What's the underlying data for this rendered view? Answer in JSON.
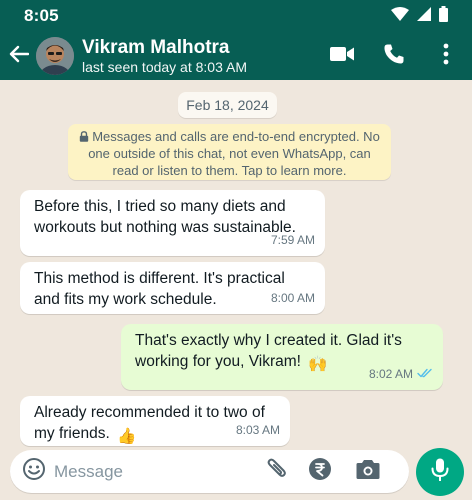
{
  "status_bar": {
    "time": "8:05",
    "icons": [
      "wifi-icon",
      "signal-icon",
      "battery-icon"
    ]
  },
  "header": {
    "contact_name": "Vikram Malhotra",
    "contact_status": "last seen today at 8:03 AM",
    "icons": [
      "back-arrow-icon",
      "avatar",
      "video-call-icon",
      "phone-icon",
      "more-options-icon"
    ]
  },
  "chat": {
    "date_chip": "Feb 18, 2024",
    "encryption_notice": "Messages and calls are end-to-end encrypted. No one outside of this chat, not even WhatsApp, can read or listen to them. Tap to learn more.",
    "messages": [
      {
        "direction": "incoming",
        "text": "Before this, I tried so many diets and workouts but nothing was sustainable.",
        "time": "7:59 AM"
      },
      {
        "direction": "incoming",
        "text": "This method is different. It's practical and fits my work schedule.",
        "time": "8:00 AM"
      },
      {
        "direction": "outgoing",
        "text": "That's exactly why I created it. Glad it's working for you, Vikram!",
        "emoji": "🙌",
        "time": "8:02 AM",
        "status": "read"
      },
      {
        "direction": "incoming",
        "text": "Already recommended it to two of my friends.",
        "emoji": "👍",
        "time": "8:03 AM"
      }
    ]
  },
  "composer": {
    "placeholder": "Message",
    "icons": [
      "emoji-icon",
      "attach-icon",
      "rupee-payment-icon",
      "camera-icon",
      "mic-icon"
    ]
  },
  "colors": {
    "header": "#075e54",
    "chat_background": "#efe7dd",
    "outgoing_bubble": "#e7fcd4",
    "incoming_bubble": "#ffffff",
    "notice_background": "#fdf3c5",
    "accent": "#00a884",
    "read_ticks": "#53bdeb"
  }
}
